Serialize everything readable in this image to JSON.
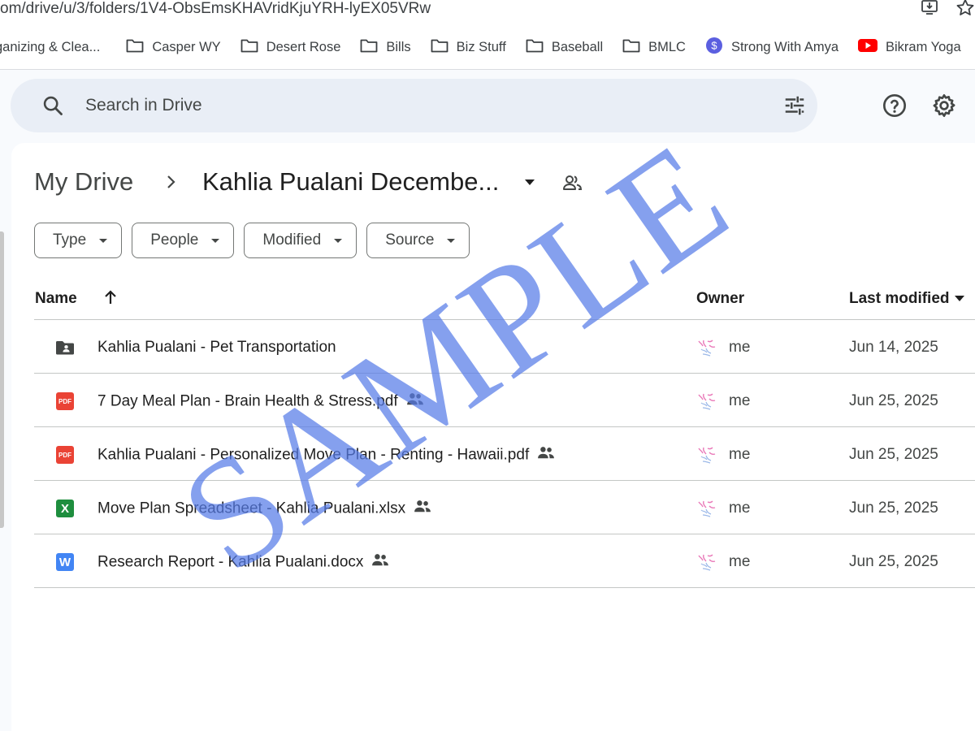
{
  "browser": {
    "url": "om/drive/u/3/folders/1V4-ObsEmsKHAVridKjuYRH-lyEX05VRw",
    "bookmarks": [
      {
        "label": "ganizing & Clea...",
        "icon": "folder-icon"
      },
      {
        "label": "Casper WY",
        "icon": "folder-icon"
      },
      {
        "label": "Desert Rose",
        "icon": "folder-icon"
      },
      {
        "label": "Bills",
        "icon": "folder-icon"
      },
      {
        "label": "Biz Stuff",
        "icon": "folder-icon"
      },
      {
        "label": "Baseball",
        "icon": "folder-icon"
      },
      {
        "label": "BMLC",
        "icon": "folder-icon"
      },
      {
        "label": "Strong With Amya",
        "icon": "dollar-circle-icon"
      },
      {
        "label": "Bikram Yoga",
        "icon": "youtube-icon"
      }
    ]
  },
  "search": {
    "placeholder": "Search in Drive"
  },
  "breadcrumb": {
    "root": "My Drive",
    "current": "Kahlia Pualani Decembe..."
  },
  "filters": [
    "Type",
    "People",
    "Modified",
    "Source"
  ],
  "columns": {
    "name": "Name",
    "owner": "Owner",
    "modified": "Last modified"
  },
  "files": [
    {
      "name": "Kahlia Pualani - Pet Transportation",
      "type": "shared-folder",
      "shared": false,
      "owner": "me",
      "modified": "Jun 14, 2025"
    },
    {
      "name": "7 Day Meal Plan - Brain Health & Stress.pdf",
      "type": "pdf",
      "shared": true,
      "owner": "me",
      "modified": "Jun 25, 2025"
    },
    {
      "name": "Kahlia Pualani - Personalized Move Plan - Renting - Hawaii.pdf",
      "type": "pdf",
      "shared": true,
      "owner": "me",
      "modified": "Jun 25, 2025"
    },
    {
      "name": "Move Plan Spreadsheet - Kahlia Pualani.xlsx",
      "type": "xlsx",
      "shared": true,
      "owner": "me",
      "modified": "Jun 25, 2025"
    },
    {
      "name": "Research Report - Kahlia Pualani.docx",
      "type": "docx",
      "shared": true,
      "owner": "me",
      "modified": "Jun 25, 2025"
    }
  ],
  "watermark": "SAMPLE",
  "colors": {
    "pdf": "#ea4335",
    "xlsx": "#1e8e3e",
    "docx": "#4285f4",
    "watermark": "#567ce8",
    "search_bg": "#e9eef6"
  }
}
